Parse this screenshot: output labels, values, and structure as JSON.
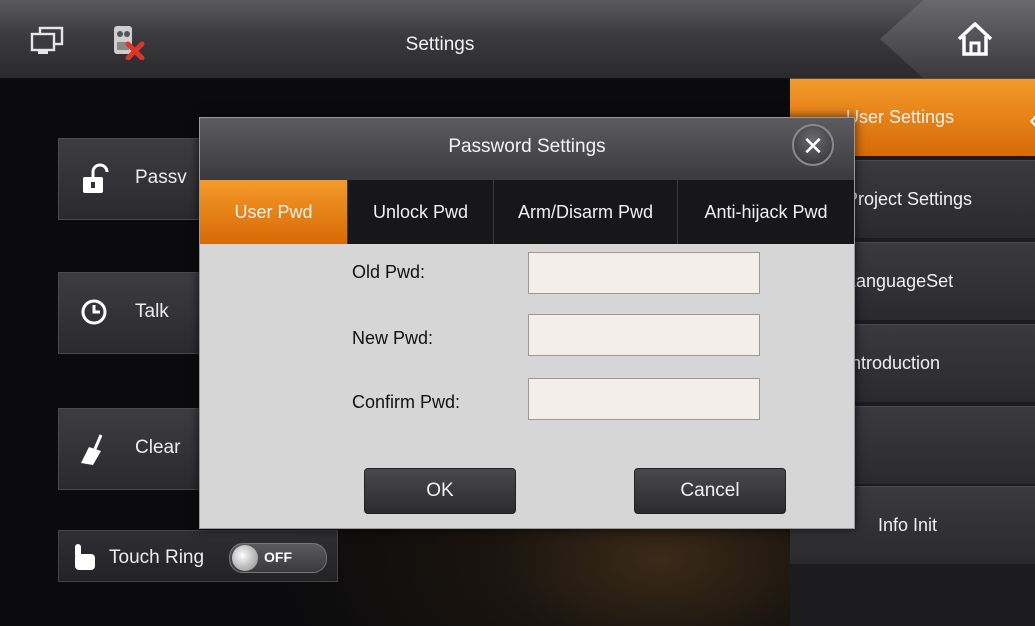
{
  "topbar": {
    "title": "Settings",
    "icons": [
      "monitor-icon",
      "alarm-disabled-icon",
      "home-icon"
    ]
  },
  "left": {
    "buttons": [
      {
        "label": "Passv",
        "icon": "unlock-icon"
      },
      {
        "label": "Talk",
        "icon": "clock-icon"
      },
      {
        "label": "Clear",
        "icon": "broom-icon"
      }
    ],
    "touch_ring": {
      "label": "Touch Ring",
      "toggle": "OFF",
      "icon": "hand-icon"
    }
  },
  "menu": {
    "items": [
      {
        "label": "User Settings",
        "active": true
      },
      {
        "label": "Project Settings"
      },
      {
        "label": "LanguageSet"
      },
      {
        "label": "Introduction"
      },
      {
        "label": ""
      },
      {
        "label": "Info Init"
      }
    ]
  },
  "dialog": {
    "title": "Password Settings",
    "tabs": [
      "User Pwd",
      "Unlock Pwd",
      "Arm/Disarm Pwd",
      "Anti-hijack Pwd"
    ],
    "active_tab": "User Pwd",
    "fields": [
      {
        "label": "Old Pwd:",
        "value": ""
      },
      {
        "label": "New Pwd:",
        "value": ""
      },
      {
        "label": "Confirm Pwd:",
        "value": ""
      }
    ],
    "ok": "OK",
    "cancel": "Cancel"
  },
  "colors": {
    "accent": "#ec8a1c",
    "dialog_bg": "#d6d6d6",
    "bar": "#3b3b3f"
  }
}
